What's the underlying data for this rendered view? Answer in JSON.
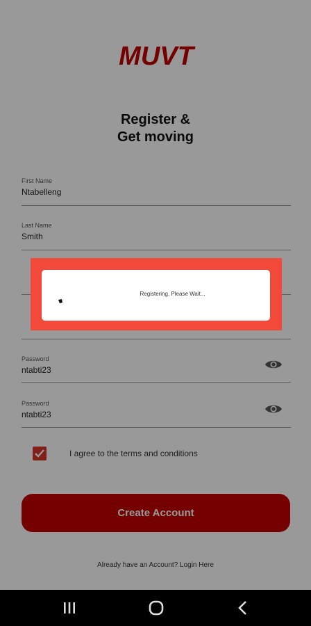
{
  "app": {
    "logo_text": "MUVT",
    "brand_color": "#c10000"
  },
  "header": {
    "title": "Register &\nGet moving"
  },
  "form": {
    "first_name": {
      "label": "First Name",
      "value": "Ntabelleng"
    },
    "last_name": {
      "label": "Last Name",
      "value": "Smith"
    },
    "password": {
      "label": "Password",
      "value": "ntabti23"
    },
    "confirm_password": {
      "label": "Password",
      "value": "ntabti23"
    },
    "terms": {
      "label": "I agree to the terms and conditions",
      "checked": true
    },
    "create_button": "Create Account",
    "login_link": "Already have an Account? Login Here"
  },
  "dialog": {
    "message": "Registering, Please Wait..."
  },
  "navbar": {
    "icons": [
      "recent-apps-icon",
      "home-icon",
      "back-icon"
    ]
  }
}
